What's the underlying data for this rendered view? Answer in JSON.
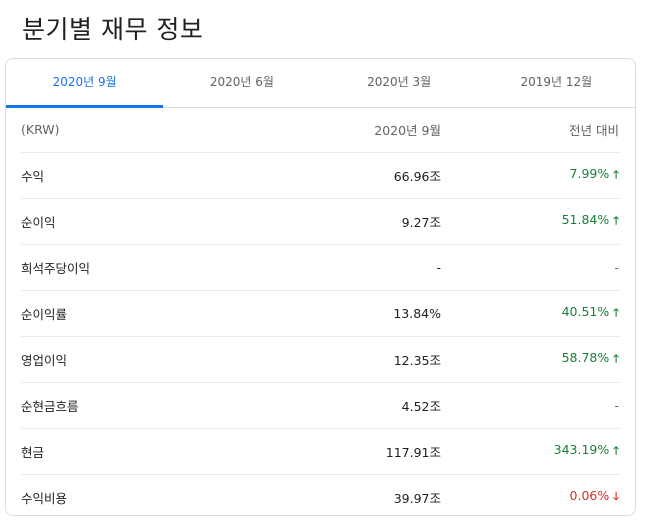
{
  "page_title": "분기별 재무 정보",
  "tabs": [
    {
      "label": "2020년 9월",
      "active": true
    },
    {
      "label": "2020년 6월",
      "active": false
    },
    {
      "label": "2020년 3월",
      "active": false
    },
    {
      "label": "2019년 12월",
      "active": false
    }
  ],
  "table": {
    "header": {
      "label": "(KRW)",
      "value": "2020년 9월",
      "change": "전년 대비"
    },
    "rows": [
      {
        "label": "수익",
        "value": "66.96조",
        "change": "7.99%",
        "trend": "up"
      },
      {
        "label": "순이익",
        "value": "9.27조",
        "change": "51.84%",
        "trend": "up"
      },
      {
        "label": "희석주당이익",
        "value": "-",
        "change": "-",
        "trend": "none"
      },
      {
        "label": "순이익률",
        "value": "13.84%",
        "change": "40.51%",
        "trend": "up"
      },
      {
        "label": "영업이익",
        "value": "12.35조",
        "change": "58.78%",
        "trend": "up"
      },
      {
        "label": "순현금흐름",
        "value": "4.52조",
        "change": "-",
        "trend": "none"
      },
      {
        "label": "현금",
        "value": "117.91조",
        "change": "343.19%",
        "trend": "up"
      },
      {
        "label": "수익비용",
        "value": "39.97조",
        "change": "0.06%",
        "trend": "down"
      }
    ]
  },
  "colors": {
    "accent": "#1a73e8",
    "positive": "#188038",
    "negative": "#d93025"
  }
}
